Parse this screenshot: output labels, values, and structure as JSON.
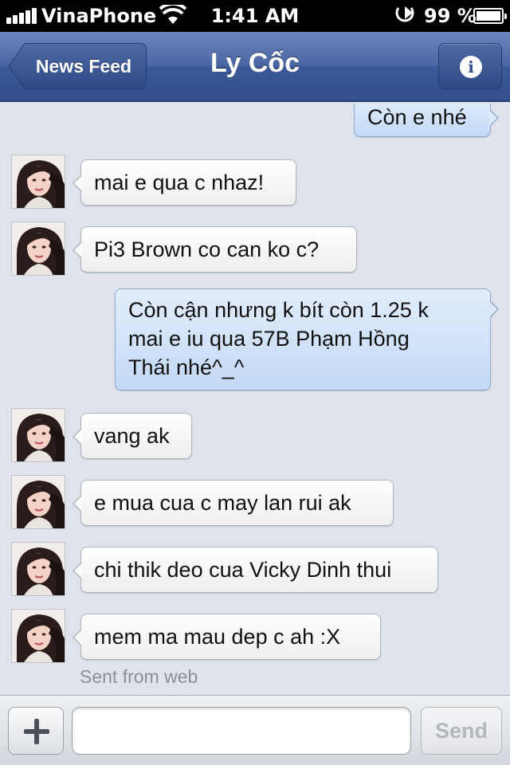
{
  "status_bar": {
    "carrier": "VinaPhone",
    "time": "1:41 AM",
    "battery_percent": "99 %",
    "icons": [
      "signal-icon",
      "wifi-icon",
      "location-arrow-icon",
      "battery-icon"
    ]
  },
  "nav": {
    "back_label": "News Feed",
    "title": "Ly Cốc",
    "info_icon": "i"
  },
  "messages": [
    {
      "direction": "out",
      "text": "Còn e nhé"
    },
    {
      "direction": "in",
      "text": "mai e qua c nhaz!"
    },
    {
      "direction": "in",
      "text": "Pi3 Brown co can ko c?"
    },
    {
      "direction": "out",
      "lines": [
        "Còn cận nhưng k bít còn 1.25 k",
        "mai e iu qua 57B Phạm Hồng",
        "Thái nhé^_^"
      ]
    },
    {
      "direction": "in",
      "text": "vang ak"
    },
    {
      "direction": "in",
      "text": "e mua cua c may lan rui ak"
    },
    {
      "direction": "in",
      "text": "chi thik deo cua Vicky Dinh thui"
    },
    {
      "direction": "in",
      "text": "mem ma mau dep c ah :X"
    }
  ],
  "sent_from": "Sent from web",
  "composer": {
    "input_value": "",
    "send_label": "Send",
    "add_icon": "plus-icon"
  },
  "colors": {
    "nav_blue": "#3b5998",
    "outgoing_bubble": "#c9dcf6",
    "incoming_bubble": "#ffffff",
    "background": "#dfe3ec"
  }
}
